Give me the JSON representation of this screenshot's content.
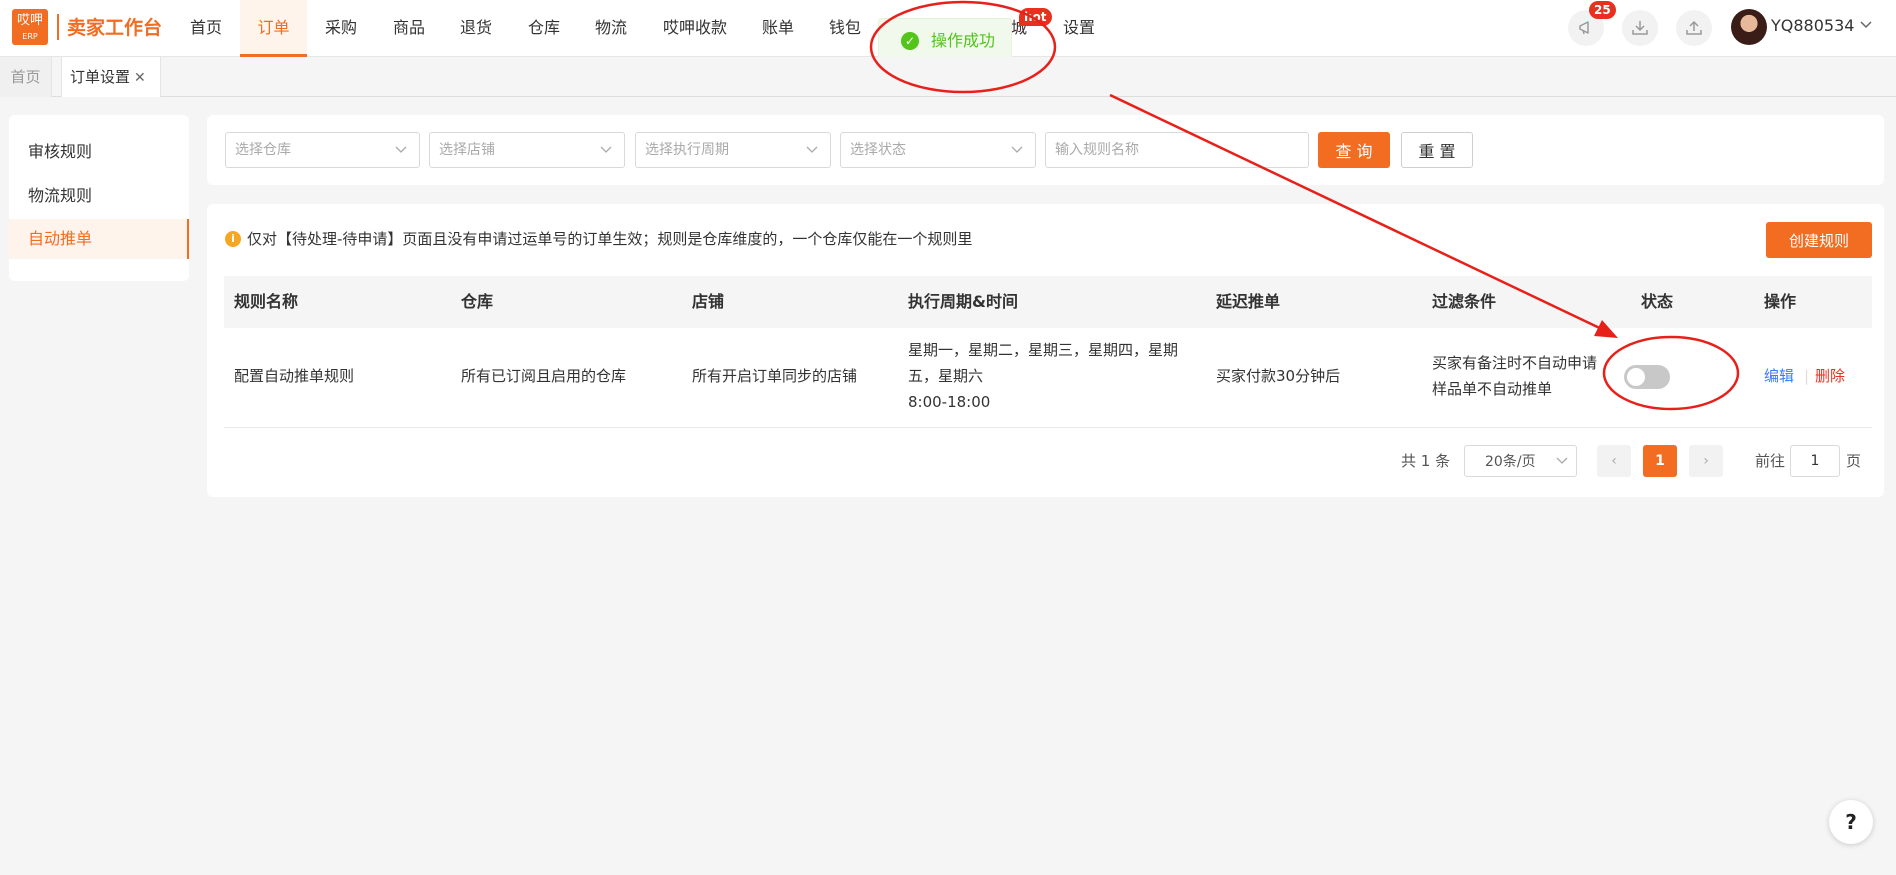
{
  "header": {
    "logo_top": "哎呷",
    "logo_bottom": "ERP",
    "app_title": "卖家工作台",
    "nav": [
      "首页",
      "订单",
      "采购",
      "商品",
      "退货",
      "仓库",
      "物流",
      "哎呷收款",
      "账单",
      "钱包",
      "城",
      "设置"
    ],
    "hot_badge": "hot",
    "notification_count": "25",
    "user_name": "YQ880534"
  },
  "toast": {
    "message": "操作成功"
  },
  "tabs": {
    "home": "首页",
    "current": "订单设置",
    "close_glyph": "✕"
  },
  "left_menu": [
    "审核规则",
    "物流规则",
    "自动推单"
  ],
  "filters": {
    "warehouse_placeholder": "选择仓库",
    "shop_placeholder": "选择店铺",
    "period_placeholder": "选择执行周期",
    "status_placeholder": "选择状态",
    "rule_name_placeholder": "输入规则名称",
    "query_label": "查 询",
    "reset_label": "重 置"
  },
  "notice": {
    "icon": "i",
    "text": "仅对【待处理-待申请】页面且没有申请过运单号的订单生效；规则是仓库维度的，一个仓库仅能在一个规则里",
    "create_label": "创建规则"
  },
  "table": {
    "headers": [
      "规则名称",
      "仓库",
      "店铺",
      "执行周期&时间",
      "延迟推单",
      "过滤条件",
      "状态",
      "操作"
    ],
    "row": {
      "name": "配置自动推单规则",
      "warehouse": "所有已订阅且启用的仓库",
      "shop": "所有开启订单同步的店铺",
      "period_line1": "星期一，星期二，星期三，星期四，星期",
      "period_line2": "五，星期六",
      "period_time": "8:00-18:00",
      "delay": "买家付款30分钟后",
      "filter_line1": "买家有备注时不自动申请",
      "filter_line2": "样品单不自动推单",
      "status_on": false,
      "edit_label": "编辑",
      "separator": "|",
      "delete_label": "删除"
    }
  },
  "pagination": {
    "total": "共 1 条",
    "page_size": "20条/页",
    "current_page": "1",
    "goto_label": "前往",
    "goto_value": "1",
    "page_suffix": "页",
    "prev_glyph": "‹",
    "next_glyph": "›"
  },
  "help": {
    "label": "?"
  },
  "colors": {
    "brand": "#f26c21",
    "success": "#52c41a",
    "danger": "#e8301f",
    "link": "#3a7bff",
    "annotation": "#e8201a"
  }
}
